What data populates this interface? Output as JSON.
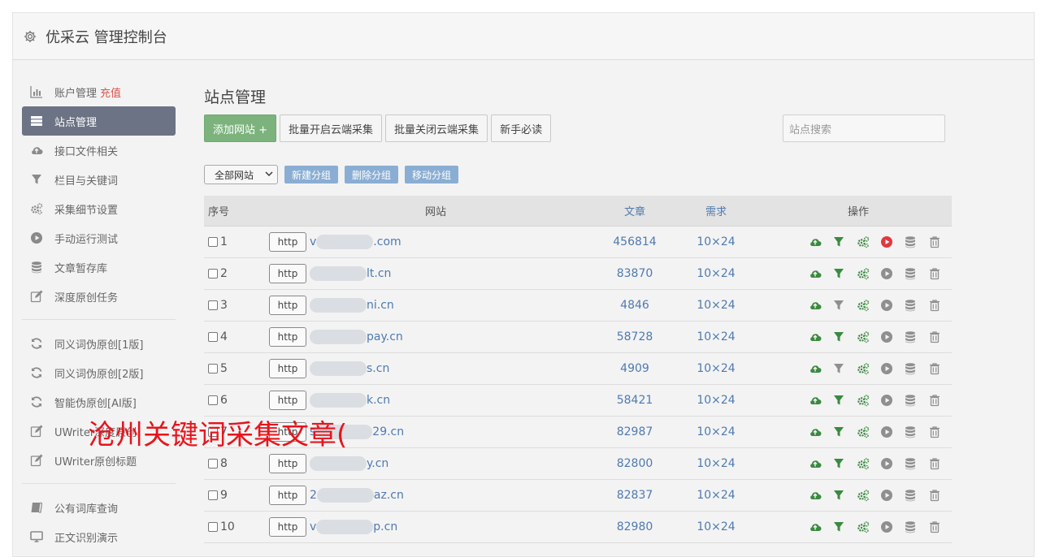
{
  "app": {
    "title": "优采云 管理控制台"
  },
  "sidebar": {
    "items": [
      {
        "label": "账户管理",
        "extra": "充值",
        "icon": "bar-chart-icon"
      },
      {
        "label": "站点管理",
        "icon": "server-icon",
        "active": true
      },
      {
        "label": "接口文件相关",
        "icon": "cloud-upload-icon"
      },
      {
        "label": "栏目与关键词",
        "icon": "filter-icon"
      },
      {
        "label": "采集细节设置",
        "icon": "cogs-icon"
      },
      {
        "label": "手动运行测试",
        "icon": "play-circle-icon"
      },
      {
        "label": "文章暂存库",
        "icon": "database-icon"
      },
      {
        "label": "深度原创任务",
        "icon": "edit-icon"
      }
    ],
    "items2": [
      {
        "label": "同义词伪原创[1版]",
        "icon": "refresh-icon"
      },
      {
        "label": "同义词伪原创[2版]",
        "icon": "refresh-icon"
      },
      {
        "label": "智能伪原创[AI版]",
        "icon": "refresh-icon"
      },
      {
        "label": "UWriter深度原创",
        "icon": "edit-icon"
      },
      {
        "label": "UWriter原创标题",
        "icon": "edit-icon"
      }
    ],
    "items3": [
      {
        "label": "公有词库查询",
        "icon": "book-icon"
      },
      {
        "label": "正文识别演示",
        "icon": "monitor-icon"
      }
    ]
  },
  "main": {
    "title": "站点管理",
    "buttons": {
      "add": "添加网站 +",
      "batch_on": "批量开启云端采集",
      "batch_off": "批量关闭云端采集",
      "guide": "新手必读"
    },
    "search_placeholder": "站点搜索",
    "group_select": "全部网站",
    "group_buttons": {
      "new": "新建分组",
      "delete": "删除分组",
      "move": "移动分组"
    },
    "columns": {
      "no": "序号",
      "site": "网站",
      "articles": "文章",
      "demand": "需求",
      "ops": "操作"
    },
    "rows": [
      {
        "no": "1",
        "http": "http",
        "prefix": "v",
        "suffix": ".com",
        "articles": "456814",
        "demand": "10×24",
        "play_active": true,
        "filter_active": true
      },
      {
        "no": "2",
        "http": "http",
        "prefix": "",
        "suffix": "lt.cn",
        "articles": "83870",
        "demand": "10×24",
        "play_active": false,
        "filter_active": true
      },
      {
        "no": "3",
        "http": "http",
        "prefix": "",
        "suffix": "ni.cn",
        "articles": "4846",
        "demand": "10×24",
        "play_active": false,
        "filter_active": false
      },
      {
        "no": "4",
        "http": "http",
        "prefix": "",
        "suffix": "pay.cn",
        "articles": "58728",
        "demand": "10×24",
        "play_active": false,
        "filter_active": true
      },
      {
        "no": "5",
        "http": "http",
        "prefix": "",
        "suffix": "s.cn",
        "articles": "4909",
        "demand": "10×24",
        "play_active": false,
        "filter_active": false
      },
      {
        "no": "6",
        "http": "http",
        "prefix": "",
        "suffix": "k.cn",
        "articles": "58421",
        "demand": "10×24",
        "play_active": false,
        "filter_active": true
      },
      {
        "no": "7",
        "http": "http",
        "prefix": "s",
        "suffix": "29.cn",
        "articles": "82987",
        "demand": "10×24",
        "play_active": false,
        "filter_active": true
      },
      {
        "no": "8",
        "http": "http",
        "prefix": "",
        "suffix": "y.cn",
        "articles": "82800",
        "demand": "10×24",
        "play_active": false,
        "filter_active": true
      },
      {
        "no": "9",
        "http": "http",
        "prefix": "2",
        "suffix": "az.cn",
        "articles": "82837",
        "demand": "10×24",
        "play_active": false,
        "filter_active": true
      },
      {
        "no": "10",
        "http": "http",
        "prefix": "v",
        "suffix": "p.cn",
        "articles": "82980",
        "demand": "10×24",
        "play_active": false,
        "filter_active": true
      }
    ]
  },
  "overlay_text": "沧州关键词采集文章(",
  "colors": {
    "active_nav": "#6b7384",
    "add_button": "#7cb37d",
    "group_button": "#8aaed3",
    "link": "#4f7ab0",
    "recharge": "#d9534f",
    "overlay": "#e8141c",
    "green_icon": "#3a8a3f",
    "red_play": "#e0383e"
  }
}
